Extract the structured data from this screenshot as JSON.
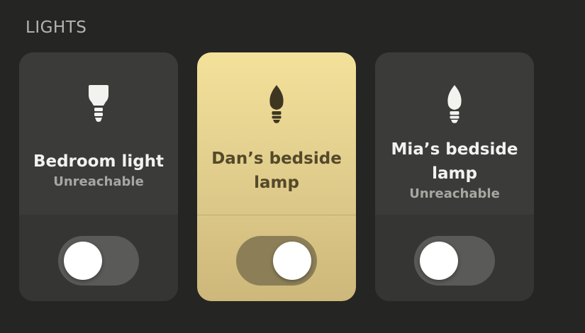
{
  "section": {
    "title": "LIGHTS"
  },
  "lights": [
    {
      "name": "Bedroom light",
      "status": "Unreachable",
      "state": "off",
      "reachable": false,
      "icon": "bulb-spot-icon"
    },
    {
      "name_line1": "Dan’s bedside",
      "name_line2": "lamp",
      "status": "",
      "state": "on",
      "reachable": true,
      "icon": "bulb-candle-icon"
    },
    {
      "name_line1": "Mia’s bedside",
      "name_line2": "lamp",
      "status": "Unreachable",
      "state": "off",
      "reachable": false,
      "icon": "bulb-candle-icon"
    }
  ],
  "colors": {
    "background": "#252524",
    "card_off": "#3b3b3a",
    "card_on_top": "#f4e19a",
    "card_on_bottom": "#cdb77a",
    "text_on_card": "#55492a",
    "status_text": "#a7a7a2"
  }
}
